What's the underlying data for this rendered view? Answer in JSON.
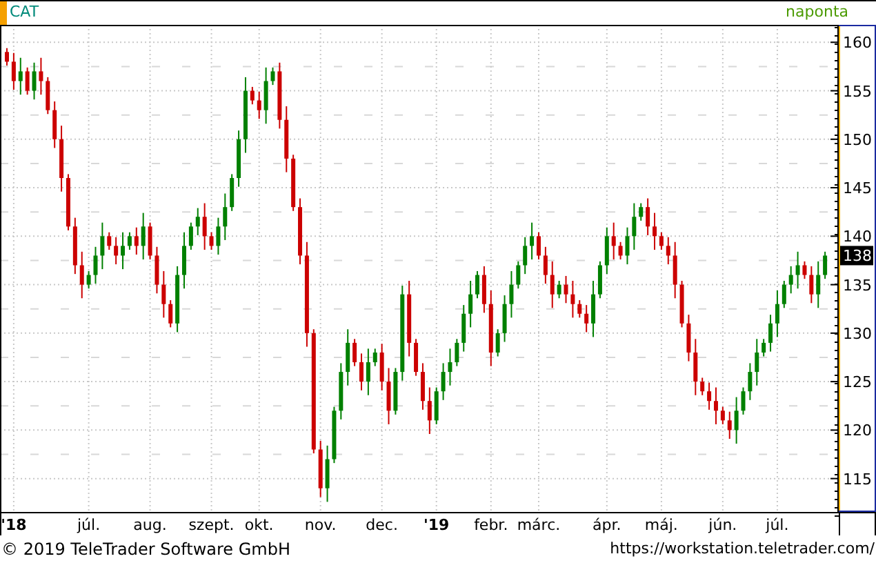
{
  "header": {
    "interval": "naponta"
  },
  "chart": {
    "chart_data": {
      "type": "candlestick",
      "title": "CAT",
      "grid": true,
      "ylim": [
        111.7,
        161.8
      ],
      "yticks": [
        115,
        120,
        125,
        130,
        135,
        140,
        145,
        150,
        155,
        160
      ],
      "categories": [
        null,
        "**'18**",
        null,
        null,
        null,
        null,
        null,
        null,
        null,
        null,
        null,
        null,
        "júl.",
        null,
        null,
        null,
        null,
        null,
        null,
        null,
        null,
        "aug.",
        null,
        null,
        null,
        null,
        null,
        null,
        null,
        null,
        "szept.",
        null,
        null,
        null,
        null,
        null,
        null,
        "okt.",
        null,
        null,
        null,
        null,
        null,
        null,
        null,
        null,
        "nov.",
        null,
        null,
        null,
        null,
        null,
        null,
        null,
        null,
        "dec.",
        null,
        null,
        null,
        null,
        null,
        null,
        null,
        "**'19**",
        null,
        null,
        null,
        null,
        null,
        null,
        null,
        "febr.",
        null,
        null,
        null,
        null,
        null,
        null,
        "márc.",
        null,
        null,
        null,
        null,
        null,
        null,
        null,
        null,
        null,
        "ápr.",
        null,
        null,
        null,
        null,
        null,
        null,
        null,
        "máj.",
        null,
        null,
        null,
        null,
        null,
        null,
        null,
        null,
        "jún.",
        null,
        null,
        null,
        null,
        null,
        null,
        null,
        "júl.",
        null,
        null,
        null,
        null,
        null,
        null,
        null
      ],
      "ohlc": [
        [
          159,
          159.4,
          157.6,
          158
        ],
        [
          158,
          158.9,
          155.1,
          156
        ],
        [
          156,
          158.4,
          154.6,
          157
        ],
        [
          157,
          157.4,
          154.6,
          155
        ],
        [
          155,
          157.9,
          154.1,
          157
        ],
        [
          157,
          158.4,
          154.6,
          156
        ],
        [
          156,
          156.4,
          152.6,
          153
        ],
        [
          153,
          153.9,
          149.1,
          150
        ],
        [
          150,
          151.4,
          144.6,
          146
        ],
        [
          146,
          146.4,
          140.6,
          141
        ],
        [
          141,
          141.9,
          136.1,
          137
        ],
        [
          137,
          138.4,
          133.6,
          135
        ],
        [
          135,
          136.4,
          134.6,
          136
        ],
        [
          136,
          138.9,
          135.1,
          138
        ],
        [
          138,
          141.4,
          136.6,
          140
        ],
        [
          140,
          140.4,
          138.6,
          139
        ],
        [
          139,
          139.9,
          137.1,
          138
        ],
        [
          138,
          140.4,
          136.6,
          139
        ],
        [
          139,
          140.4,
          138.6,
          140
        ],
        [
          140,
          140.9,
          138.1,
          139
        ],
        [
          139,
          142.4,
          137.6,
          141
        ],
        [
          141,
          141.4,
          137.6,
          138
        ],
        [
          138,
          138.9,
          134.1,
          135
        ],
        [
          135,
          136.4,
          131.6,
          133
        ],
        [
          133,
          133.4,
          130.6,
          131
        ],
        [
          131,
          136.9,
          130.1,
          136
        ],
        [
          136,
          140.4,
          134.6,
          139
        ],
        [
          139,
          141.4,
          138.6,
          141
        ],
        [
          141,
          142.9,
          140.1,
          142
        ],
        [
          142,
          143.4,
          138.6,
          140
        ],
        [
          140,
          140.4,
          138.6,
          139
        ],
        [
          139,
          141.9,
          138.1,
          141
        ],
        [
          141,
          144.4,
          139.6,
          143
        ],
        [
          143,
          146.4,
          142.6,
          146
        ],
        [
          146,
          150.9,
          145.1,
          150
        ],
        [
          150,
          156.4,
          148.6,
          155
        ],
        [
          155,
          155.4,
          153.6,
          154
        ],
        [
          154,
          154.9,
          152.1,
          153
        ],
        [
          153,
          157.4,
          151.6,
          156
        ],
        [
          156,
          157.4,
          155.6,
          157
        ],
        [
          157,
          157.9,
          151.1,
          152
        ],
        [
          152,
          153.4,
          146.6,
          148
        ],
        [
          148,
          148.4,
          142.6,
          143
        ],
        [
          143,
          143.9,
          137.1,
          138
        ],
        [
          138,
          139.4,
          128.6,
          130
        ],
        [
          130,
          130.4,
          117.6,
          118
        ],
        [
          118,
          118.9,
          113.1,
          114
        ],
        [
          114,
          118.4,
          112.6,
          117
        ],
        [
          117,
          122.4,
          116.6,
          122
        ],
        [
          122,
          126.9,
          121.1,
          126
        ],
        [
          126,
          130.4,
          124.6,
          129
        ],
        [
          129,
          129.4,
          126.6,
          127
        ],
        [
          127,
          127.9,
          124.1,
          125
        ],
        [
          125,
          128.4,
          123.6,
          127
        ],
        [
          127,
          128.4,
          126.6,
          128
        ],
        [
          128,
          128.9,
          124.1,
          125
        ],
        [
          125,
          126.4,
          120.6,
          122
        ],
        [
          122,
          126.4,
          121.6,
          126
        ],
        [
          126,
          134.9,
          125.1,
          134
        ],
        [
          134,
          135.4,
          127.6,
          129
        ],
        [
          129,
          129.4,
          125.6,
          126
        ],
        [
          126,
          126.9,
          122.1,
          123
        ],
        [
          123,
          124.4,
          119.6,
          121
        ],
        [
          121,
          124.4,
          120.6,
          124
        ],
        [
          124,
          126.9,
          123.1,
          126
        ],
        [
          126,
          128.4,
          124.6,
          127
        ],
        [
          127,
          129.4,
          126.6,
          129
        ],
        [
          129,
          132.9,
          128.1,
          132
        ],
        [
          132,
          135.4,
          130.6,
          134
        ],
        [
          134,
          136.4,
          133.6,
          136
        ],
        [
          136,
          136.9,
          132.1,
          133
        ],
        [
          133,
          134.4,
          126.6,
          128
        ],
        [
          128,
          130.4,
          127.6,
          130
        ],
        [
          130,
          133.9,
          129.1,
          133
        ],
        [
          133,
          136.4,
          131.6,
          135
        ],
        [
          135,
          137.4,
          134.6,
          137
        ],
        [
          137,
          139.9,
          136.1,
          139
        ],
        [
          139,
          141.4,
          137.6,
          140
        ],
        [
          140,
          140.4,
          137.6,
          138
        ],
        [
          138,
          138.9,
          135.1,
          136
        ],
        [
          136,
          137.4,
          132.6,
          134
        ],
        [
          134,
          135.4,
          133.6,
          135
        ],
        [
          135,
          135.9,
          133.1,
          134
        ],
        [
          134,
          135.4,
          131.6,
          133
        ],
        [
          133,
          133.4,
          131.6,
          132
        ],
        [
          132,
          132.9,
          130.1,
          131
        ],
        [
          131,
          135.4,
          129.6,
          134
        ],
        [
          134,
          137.4,
          133.6,
          137
        ],
        [
          137,
          140.9,
          136.1,
          140
        ],
        [
          140,
          141.4,
          137.6,
          139
        ],
        [
          139,
          139.4,
          137.6,
          138
        ],
        [
          138,
          140.9,
          137.1,
          140
        ],
        [
          140,
          143.4,
          138.6,
          142
        ],
        [
          142,
          143.4,
          141.6,
          143
        ],
        [
          143,
          143.9,
          140.1,
          141
        ],
        [
          141,
          142.4,
          138.6,
          140
        ],
        [
          140,
          140.4,
          138.6,
          139
        ],
        [
          139,
          139.9,
          137.1,
          138
        ],
        [
          138,
          139.4,
          133.6,
          135
        ],
        [
          135,
          135.4,
          130.6,
          131
        ],
        [
          131,
          131.9,
          127.1,
          128
        ],
        [
          128,
          129.4,
          123.6,
          125
        ],
        [
          125,
          125.4,
          123.6,
          124
        ],
        [
          124,
          124.9,
          122.1,
          123
        ],
        [
          123,
          124.4,
          120.6,
          122
        ],
        [
          122,
          122.4,
          120.6,
          121
        ],
        [
          121,
          121.9,
          119.1,
          120
        ],
        [
          120,
          123.4,
          118.6,
          122
        ],
        [
          122,
          124.4,
          121.6,
          124
        ],
        [
          124,
          126.9,
          123.1,
          126
        ],
        [
          126,
          129.4,
          124.6,
          128
        ],
        [
          128,
          129.4,
          127.6,
          129
        ],
        [
          129,
          131.9,
          128.1,
          131
        ],
        [
          131,
          134.4,
          129.6,
          133
        ],
        [
          133,
          135.4,
          132.6,
          135
        ],
        [
          135,
          136.9,
          134.1,
          136
        ],
        [
          136,
          138.4,
          134.6,
          137
        ],
        [
          137,
          137.4,
          135.6,
          136
        ],
        [
          136,
          136.9,
          133.1,
          134
        ],
        [
          134,
          137.4,
          132.6,
          136
        ],
        [
          136,
          138.4,
          135.6,
          138
        ]
      ]
    },
    "last_price_label": "138"
  },
  "footer": {
    "copyright": "© 2019 TeleTrader Software GmbH",
    "url": "https://workstation.teletrader.com/"
  }
}
